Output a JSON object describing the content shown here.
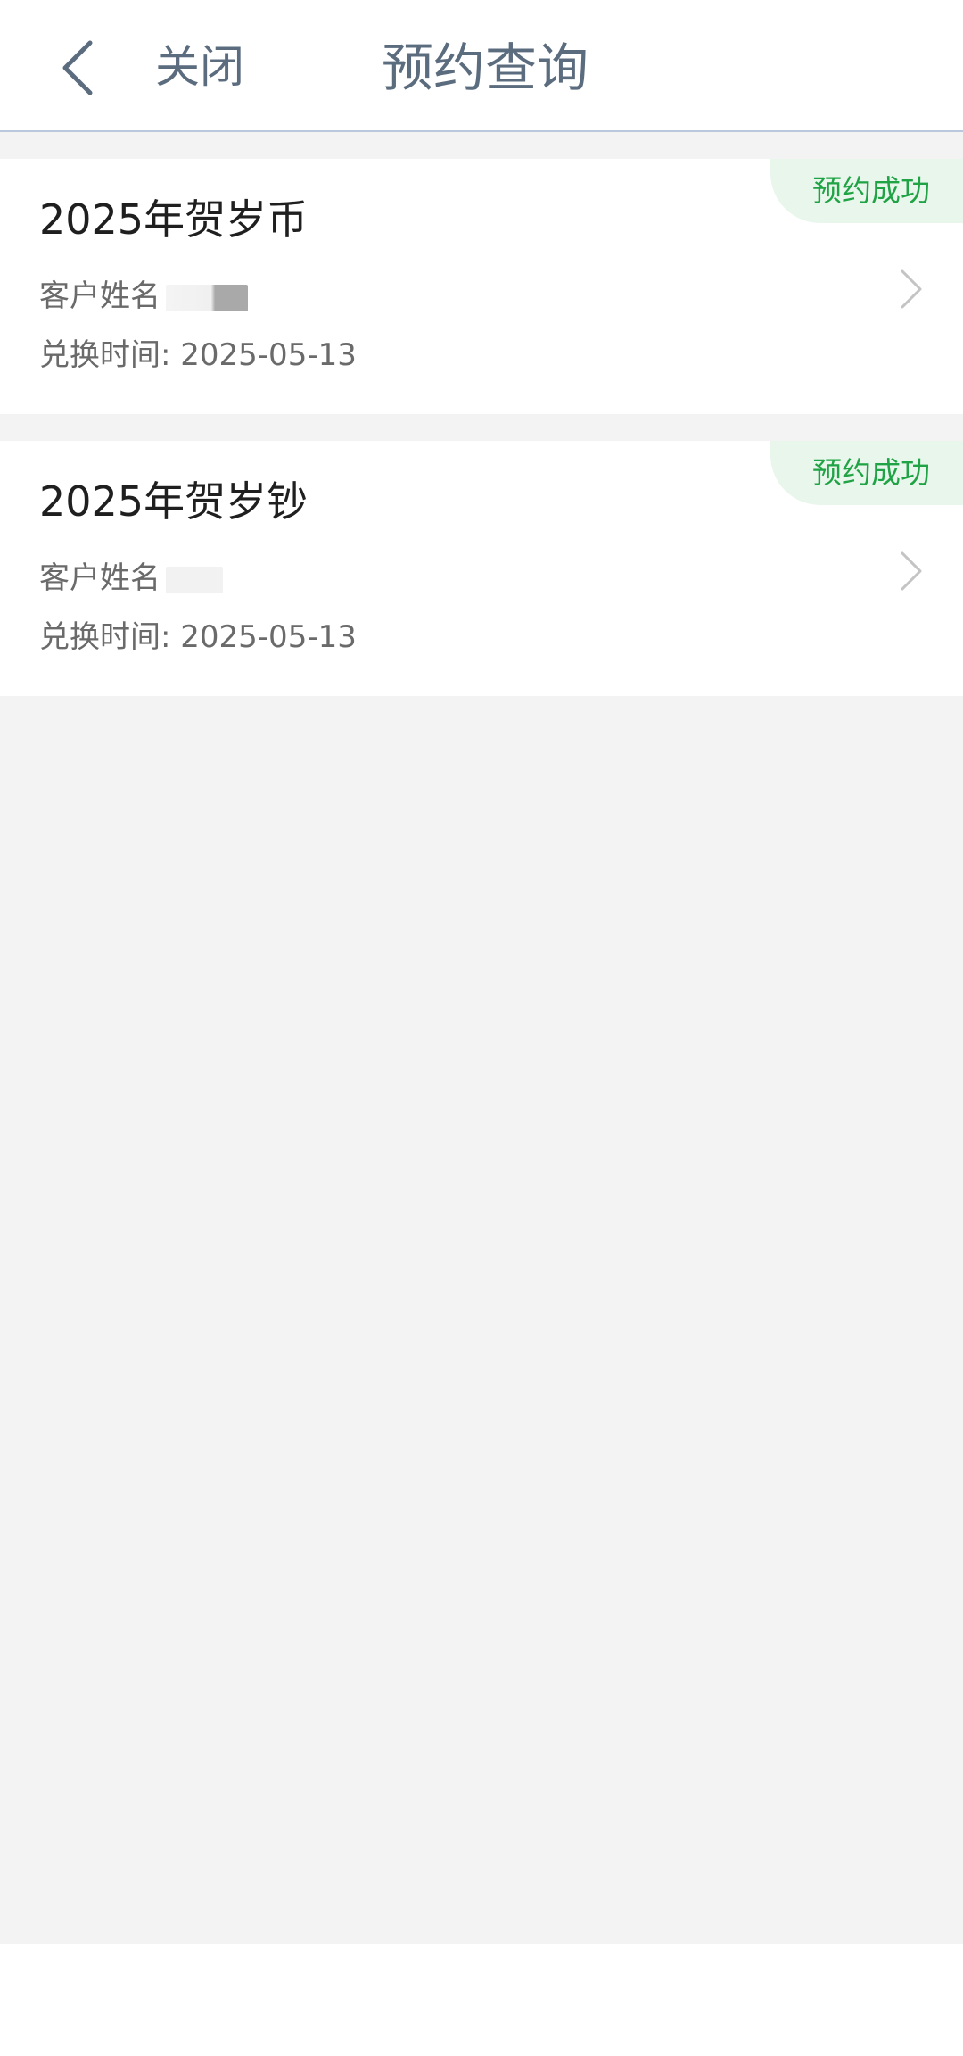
{
  "header": {
    "back_icon": "chevron-left-icon",
    "close_label": "关闭",
    "title": "预约查询"
  },
  "cards": [
    {
      "title": "2025年贺岁币",
      "status": "预约成功",
      "customer_name_label": "客户姓名",
      "exchange_time": "兑换时间: 2025-05-13"
    },
    {
      "title": "2025年贺岁钞",
      "status": "预约成功",
      "customer_name_label": "客户姓名",
      "exchange_time": "兑换时间: 2025-05-13"
    }
  ],
  "colors": {
    "accent_green": "#1fa344",
    "badge_bg": "#e8f6ec",
    "header_text": "#5c6c7f",
    "page_bg": "#f3f3f3"
  }
}
